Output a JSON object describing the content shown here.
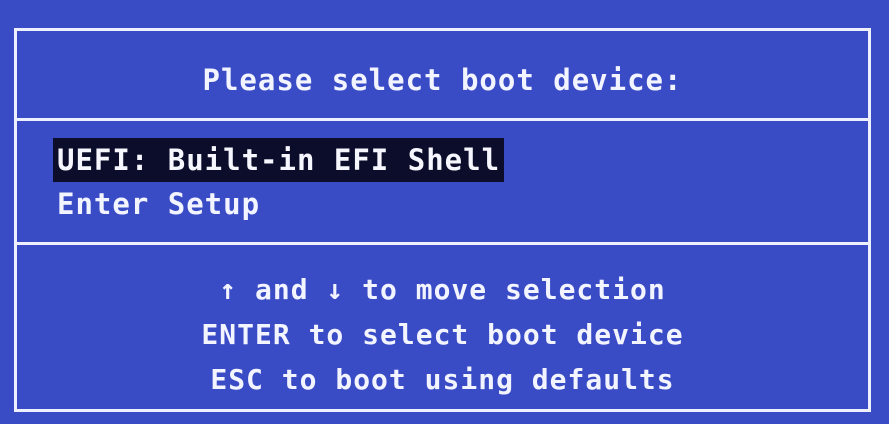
{
  "title": "Please select boot device:",
  "menu": {
    "items": [
      {
        "label": "UEFI: Built-in EFI Shell",
        "selected": true
      },
      {
        "label": "Enter Setup",
        "selected": false
      }
    ]
  },
  "help": {
    "lines": [
      "↑ and ↓ to move selection",
      "ENTER to select boot device",
      "ESC to boot using defaults"
    ]
  },
  "colors": {
    "background": "#3a4bc6",
    "text": "#f2f4ff",
    "selection": "#0c0d2a"
  }
}
